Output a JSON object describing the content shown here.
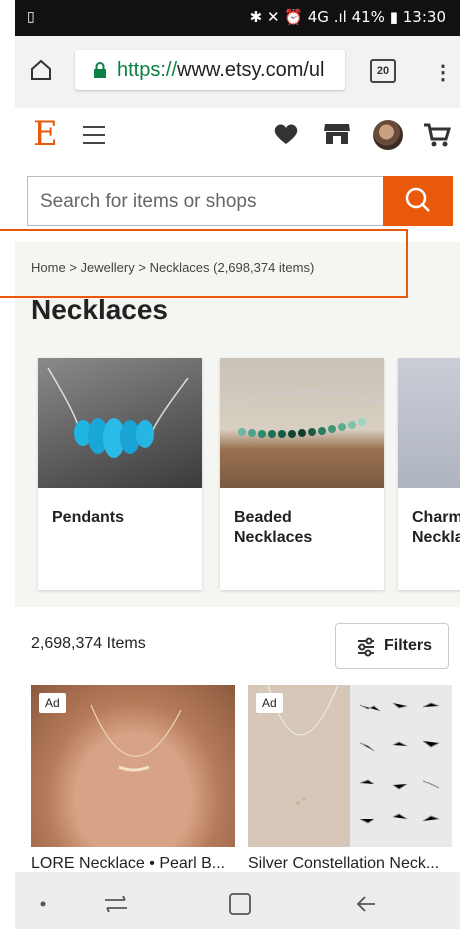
{
  "status_bar": {
    "left_icon": "gallery-notification-icon",
    "battery_text": "41%",
    "time": "13:30",
    "signal_text": "4G .ıl"
  },
  "browser": {
    "url_scheme": "https://",
    "url_rest": "www.etsy.com/ul",
    "tab_count": "20"
  },
  "header": {
    "logo": "E"
  },
  "search": {
    "placeholder": "Search for items or shops"
  },
  "breadcrumb": {
    "home": "Home",
    "sep1": ">",
    "category": "Jewellery",
    "sep2": ">",
    "current": "Necklaces (2,698,374 items)"
  },
  "page": {
    "title": "Necklaces"
  },
  "categories": [
    {
      "label": "Pendants"
    },
    {
      "label": "Beaded\nNecklaces"
    },
    {
      "label": "Charm\nNecklaces"
    }
  ],
  "results": {
    "count": "2,698,374 Items",
    "filters_label": "Filters"
  },
  "listings": [
    {
      "badge": "Ad",
      "title": "LORE Necklace • Pearl B..."
    },
    {
      "badge": "Ad",
      "title": "Silver Constellation Neck..."
    }
  ],
  "colors": {
    "accent": "#e8590c",
    "url_green": "#0a8043",
    "page_bg": "#f5f5f1"
  }
}
